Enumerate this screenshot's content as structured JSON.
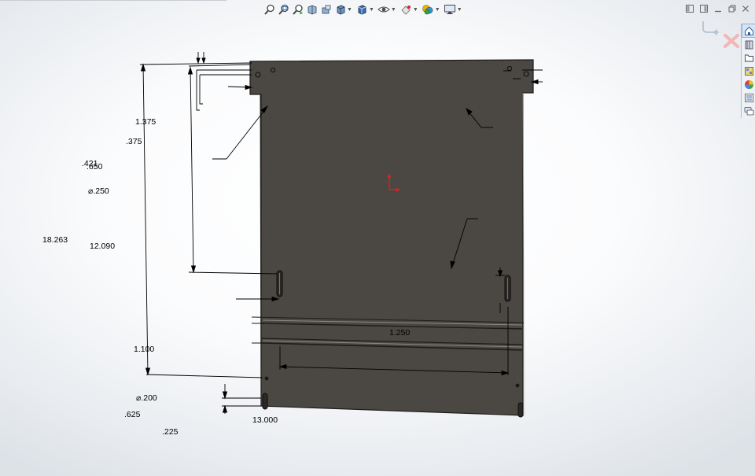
{
  "toolbar": {
    "icons": [
      "zoom-to-fit-icon",
      "zoom-to-area-icon",
      "previous-view-icon",
      "section-view-icon",
      "dynamic-annotation-icon",
      "view-orientation-icon",
      "display-style-icon",
      "hide-show-icon",
      "edit-appearance-icon",
      "apply-scene-icon",
      "view-settings-icon"
    ]
  },
  "window_controls": [
    "restore-left-icon",
    "restore-right-icon",
    "minimize-icon",
    "maximize-icon",
    "close-icon"
  ],
  "confirmation_corner": [
    "accept-icon",
    "reject-icon"
  ],
  "task_pane": [
    "home-icon",
    "design-library-icon",
    "file-explorer-icon",
    "view-palette-icon",
    "appearances-icon",
    "custom-properties-icon",
    "forum-icon"
  ],
  "dimensions": {
    "d1375": "1.375",
    "d375": ".375",
    "d421": ".421",
    "d650": ".650",
    "dia250": "⌀.250",
    "d18263": "18.263",
    "d12090": "12.090",
    "d1250": "1.250",
    "d1100": "1.100",
    "dia200": "⌀.200",
    "d625": ".625",
    "d225": ".225",
    "d13000": "13.000"
  },
  "colors": {
    "plate_fill": "#4b4743",
    "plate_edge": "#1f1d1b",
    "axis_red": "#e02020"
  }
}
